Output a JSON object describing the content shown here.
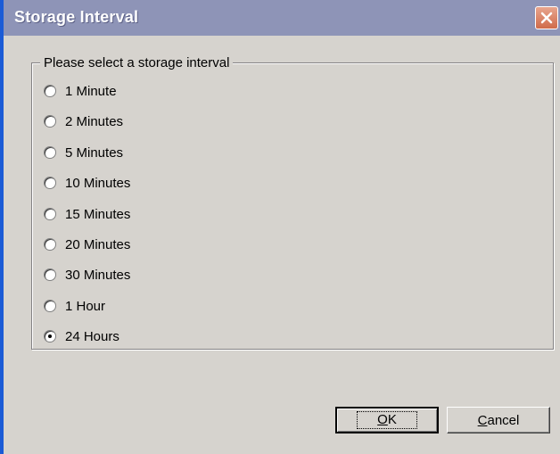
{
  "window": {
    "title": "Storage Interval",
    "close_icon": "close-icon"
  },
  "group": {
    "label": "Please select a storage interval",
    "options": [
      {
        "label": "1 Minute",
        "checked": false
      },
      {
        "label": "2 Minutes",
        "checked": false
      },
      {
        "label": "5 Minutes",
        "checked": false
      },
      {
        "label": "10 Minutes",
        "checked": false
      },
      {
        "label": "15 Minutes",
        "checked": false
      },
      {
        "label": "20 Minutes",
        "checked": false
      },
      {
        "label": "30 Minutes",
        "checked": false
      },
      {
        "label": "1 Hour",
        "checked": false
      },
      {
        "label": "24 Hours",
        "checked": true
      }
    ]
  },
  "buttons": {
    "ok": {
      "mnemonic": "O",
      "rest": "K"
    },
    "cancel": {
      "mnemonic": "C",
      "rest": "ancel"
    }
  }
}
